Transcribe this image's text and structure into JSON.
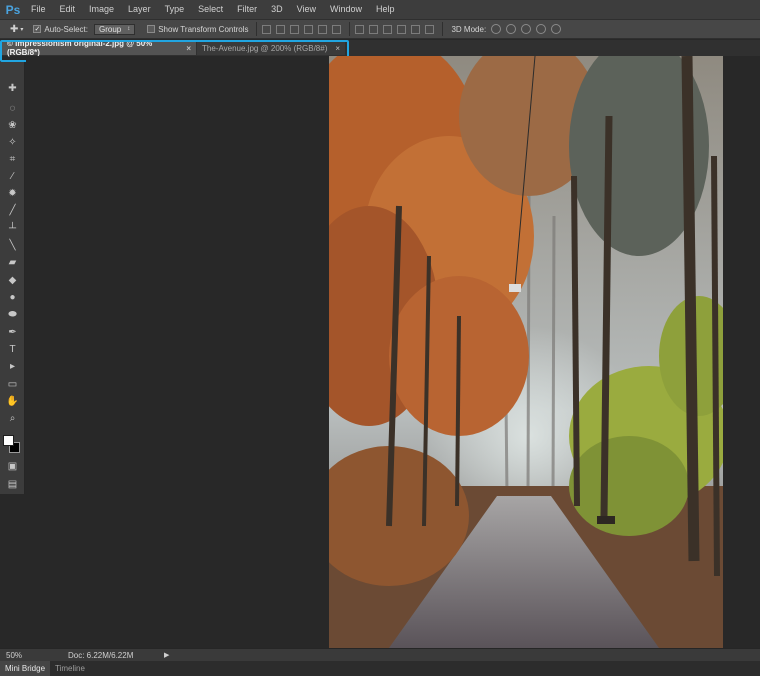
{
  "app": {
    "logo": "Ps"
  },
  "menu": [
    "File",
    "Edit",
    "Image",
    "Layer",
    "Type",
    "Select",
    "Filter",
    "3D",
    "View",
    "Window",
    "Help"
  ],
  "options": {
    "tool_icon": "move-tool-icon",
    "auto_select_label": "Auto-Select:",
    "auto_select_checked": true,
    "auto_select_value": "Group",
    "show_transform_label": "Show Transform Controls",
    "show_transform_checked": false,
    "mode_label": "3D Mode:"
  },
  "tabs": [
    {
      "label": "© Impressionism original-2.jpg @ 50% (RGB/8*)",
      "active": true,
      "close": "×"
    },
    {
      "label": "The-Avenue.jpg @ 200% (RGB/8#)",
      "active": false,
      "close": "×"
    }
  ],
  "tools": [
    {
      "name": "move-tool-icon",
      "glyph": "✚"
    },
    {
      "name": "marquee-tool-icon",
      "glyph": "◌"
    },
    {
      "name": "lasso-tool-icon",
      "glyph": "❀"
    },
    {
      "name": "quick-select-tool-icon",
      "glyph": "✧"
    },
    {
      "name": "crop-tool-icon",
      "glyph": "⌗"
    },
    {
      "name": "eyedropper-tool-icon",
      "glyph": "∕"
    },
    {
      "name": "healing-brush-tool-icon",
      "glyph": "✹"
    },
    {
      "name": "brush-tool-icon",
      "glyph": "╱"
    },
    {
      "name": "stamp-tool-icon",
      "glyph": "┴"
    },
    {
      "name": "history-brush-tool-icon",
      "glyph": "╲"
    },
    {
      "name": "eraser-tool-icon",
      "glyph": "▰"
    },
    {
      "name": "paint-bucket-tool-icon",
      "glyph": "◆"
    },
    {
      "name": "blur-tool-icon",
      "glyph": "●"
    },
    {
      "name": "dodge-tool-icon",
      "glyph": "⬬"
    },
    {
      "name": "pen-tool-icon",
      "glyph": "✒"
    },
    {
      "name": "type-tool-icon",
      "glyph": "T"
    },
    {
      "name": "path-select-tool-icon",
      "glyph": "▸"
    },
    {
      "name": "rectangle-tool-icon",
      "glyph": "▭"
    },
    {
      "name": "hand-tool-icon",
      "glyph": "✋"
    },
    {
      "name": "zoom-tool-icon",
      "glyph": "⌕"
    }
  ],
  "colors": {
    "foreground": "#ffffff",
    "background": "#000000",
    "tab_highlight": "#21a5e1"
  },
  "status": {
    "zoom": "50%",
    "doc": "Doc: 6.22M/6.22M",
    "arrow": "▶"
  },
  "panels": [
    "Mini Bridge",
    "Timeline"
  ],
  "image": {
    "subject": "autumn-forest-path-photo"
  }
}
